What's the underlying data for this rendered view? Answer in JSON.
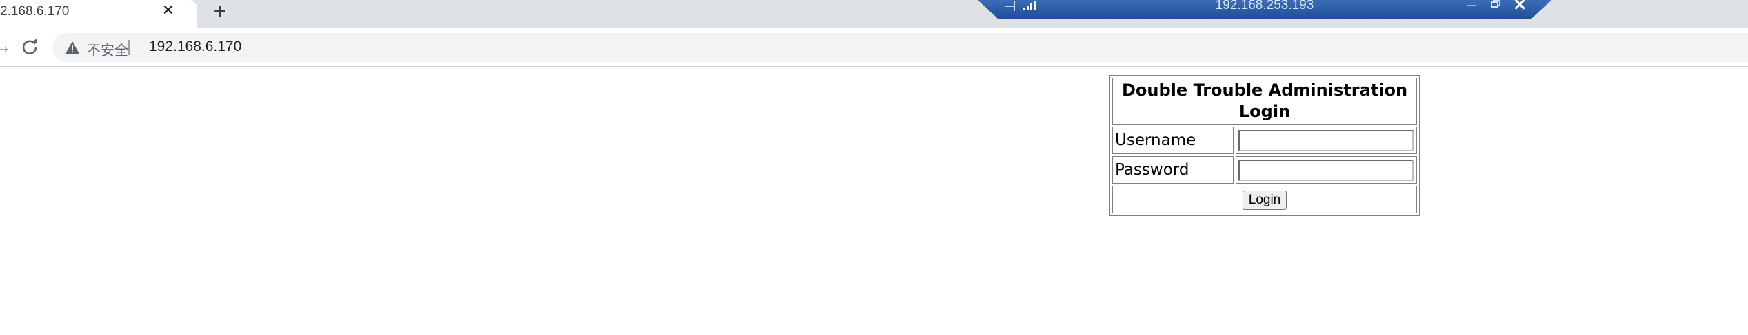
{
  "browser": {
    "tab_title": "2.168.6.170",
    "close_glyph": "✕",
    "new_tab_glyph": "+",
    "security_label": "不安全",
    "url": "192.168.6.170"
  },
  "remote_bar": {
    "host": "192.168.253.193",
    "pin_glyph": "⊣",
    "minimize_glyph": "–",
    "close_glyph": "✕"
  },
  "login_form": {
    "heading": "Double Trouble Administration Login",
    "username_label": "Username",
    "password_label": "Password",
    "username_value": "",
    "password_value": "",
    "submit_label": "Login"
  }
}
